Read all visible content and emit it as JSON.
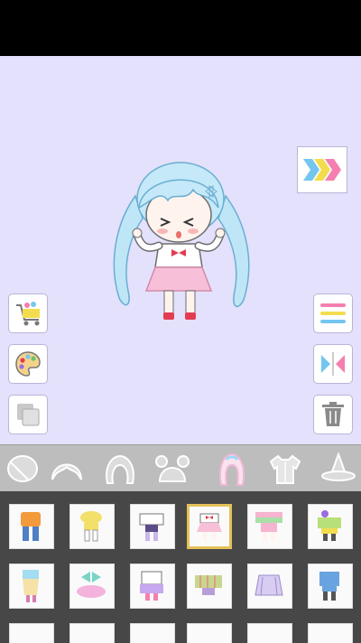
{
  "screen": {
    "canvas_bg": "#e3e1fb",
    "accent_pink": "#f57fb0",
    "accent_blue": "#74c6ef",
    "accent_yellow": "#f3dd4f",
    "selected_border": "#e4c25a"
  },
  "next_button": {
    "icon": "triple-chevron-right-icon",
    "colors": [
      "#74c6ef",
      "#f3dd4f",
      "#f57fb0"
    ]
  },
  "left_tools": [
    {
      "name": "shop-cart-button",
      "icon": "shopping-cart-icon"
    },
    {
      "name": "color-palette-button",
      "icon": "palette-icon"
    },
    {
      "name": "layers-button",
      "icon": "layers-icon"
    }
  ],
  "right_tools": [
    {
      "name": "menu-button",
      "icon": "menu-icon"
    },
    {
      "name": "flip-button",
      "icon": "flip-horizontal-icon"
    },
    {
      "name": "delete-button",
      "icon": "trash-icon"
    }
  ],
  "categories": [
    {
      "name": "face",
      "selected": false
    },
    {
      "name": "bangs",
      "selected": false
    },
    {
      "name": "hair",
      "selected": false
    },
    {
      "name": "buns",
      "selected": false
    },
    {
      "name": "full-hair",
      "selected": true
    },
    {
      "name": "top",
      "selected": false
    },
    {
      "name": "hat",
      "selected": false
    }
  ],
  "items": [
    {
      "id": 1,
      "selected": false
    },
    {
      "id": 2,
      "selected": false
    },
    {
      "id": 3,
      "selected": false
    },
    {
      "id": 4,
      "selected": true
    },
    {
      "id": 5,
      "selected": false
    },
    {
      "id": 6,
      "selected": false
    },
    {
      "id": 7,
      "selected": false
    },
    {
      "id": 8,
      "selected": false
    },
    {
      "id": 9,
      "selected": false
    },
    {
      "id": 10,
      "selected": false
    },
    {
      "id": 11,
      "selected": false
    },
    {
      "id": 12,
      "selected": false
    }
  ]
}
